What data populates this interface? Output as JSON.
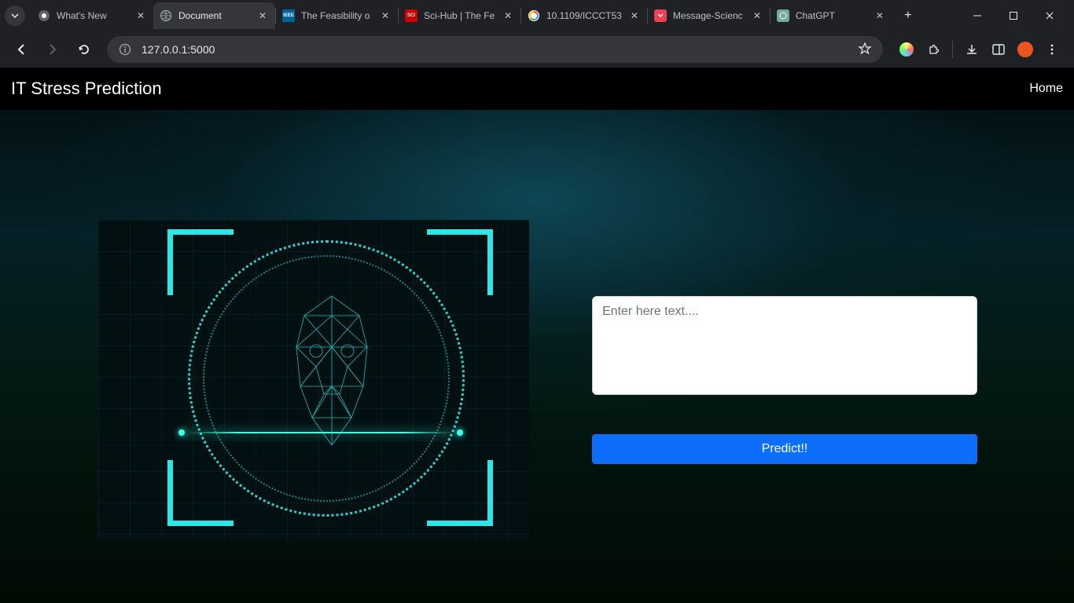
{
  "browser": {
    "tabs": [
      {
        "title": "What's New",
        "favicon": "chrome"
      },
      {
        "title": "Document",
        "favicon": "globe",
        "active": true
      },
      {
        "title": "The Feasibility o",
        "favicon": "ieee"
      },
      {
        "title": "Sci-Hub | The Fe",
        "favicon": "scihub"
      },
      {
        "title": "10.1109/ICCCT53",
        "favicon": "google"
      },
      {
        "title": "Message-Scienc",
        "favicon": "pocket"
      },
      {
        "title": "ChatGPT",
        "favicon": "chatgpt"
      }
    ],
    "url": "127.0.0.1:5000"
  },
  "app": {
    "title": "IT Stress Prediction",
    "nav_home": "Home",
    "input_placeholder": "Enter here text....",
    "input_value": "",
    "predict_label": "Predict!!"
  }
}
